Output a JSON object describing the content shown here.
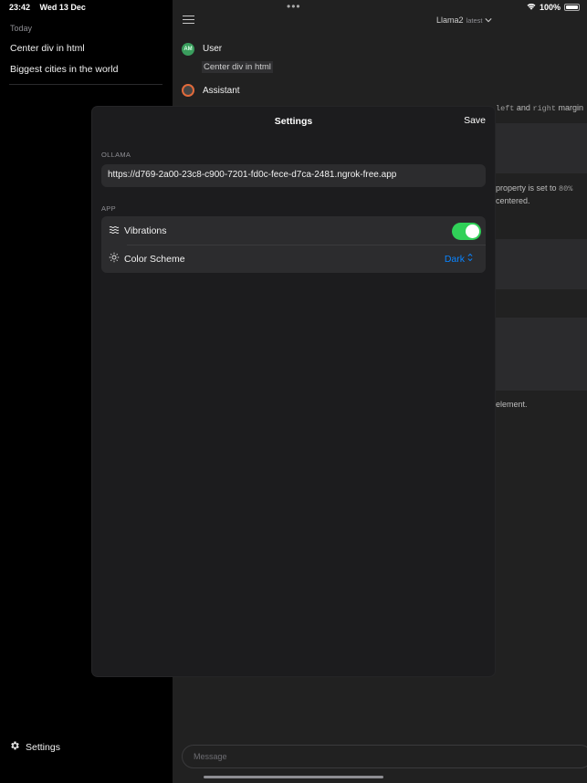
{
  "status_bar": {
    "time": "23:42",
    "date": "Wed 13 Dec",
    "battery": "100%",
    "multitask": "•••"
  },
  "sidebar": {
    "section": "Today",
    "chats": [
      {
        "title": "Center div in html"
      },
      {
        "title": "Biggest cities in the world"
      }
    ],
    "settings_label": "Settings"
  },
  "chat": {
    "model_name": "Llama2",
    "model_tag": "latest",
    "user_name": "User",
    "user_initials": "AM",
    "user_message": "Center div in html",
    "assistant_name": "Assistant",
    "bg_fragments": {
      "line1_code_a": "left",
      "line1_word": "and",
      "line1_code_b": "right",
      "line1_tail": "margin",
      "line2_text": "property is set to",
      "line2_code": "80%",
      "line3": "centered.",
      "line4": "element."
    },
    "input_placeholder": "Message"
  },
  "settings_sheet": {
    "title": "Settings",
    "save_label": "Save",
    "ollama_section": "OLLAMA",
    "ollama_url": "https://d769-2a00-23c8-c900-7201-fd0c-fece-d7ca-2481.ngrok-free.app",
    "app_section": "APP",
    "vibrations_label": "Vibrations",
    "vibrations_on": true,
    "color_scheme_label": "Color Scheme",
    "color_scheme_value": "Dark"
  },
  "colors": {
    "accent": "#0a84ff",
    "toggle_on": "#30d158",
    "user_avatar": "#3a9d5d",
    "assistant_ring": "#e06a3b"
  },
  "icons": {
    "settings": "gear-icon",
    "menu": "hamburger-icon",
    "vibrations": "waves-icon",
    "color_scheme": "sun-icon",
    "model_dropdown": "chevron-down-icon",
    "scheme_picker": "chevron-updown-icon",
    "wifi": "wifi-icon",
    "battery": "battery-icon"
  }
}
